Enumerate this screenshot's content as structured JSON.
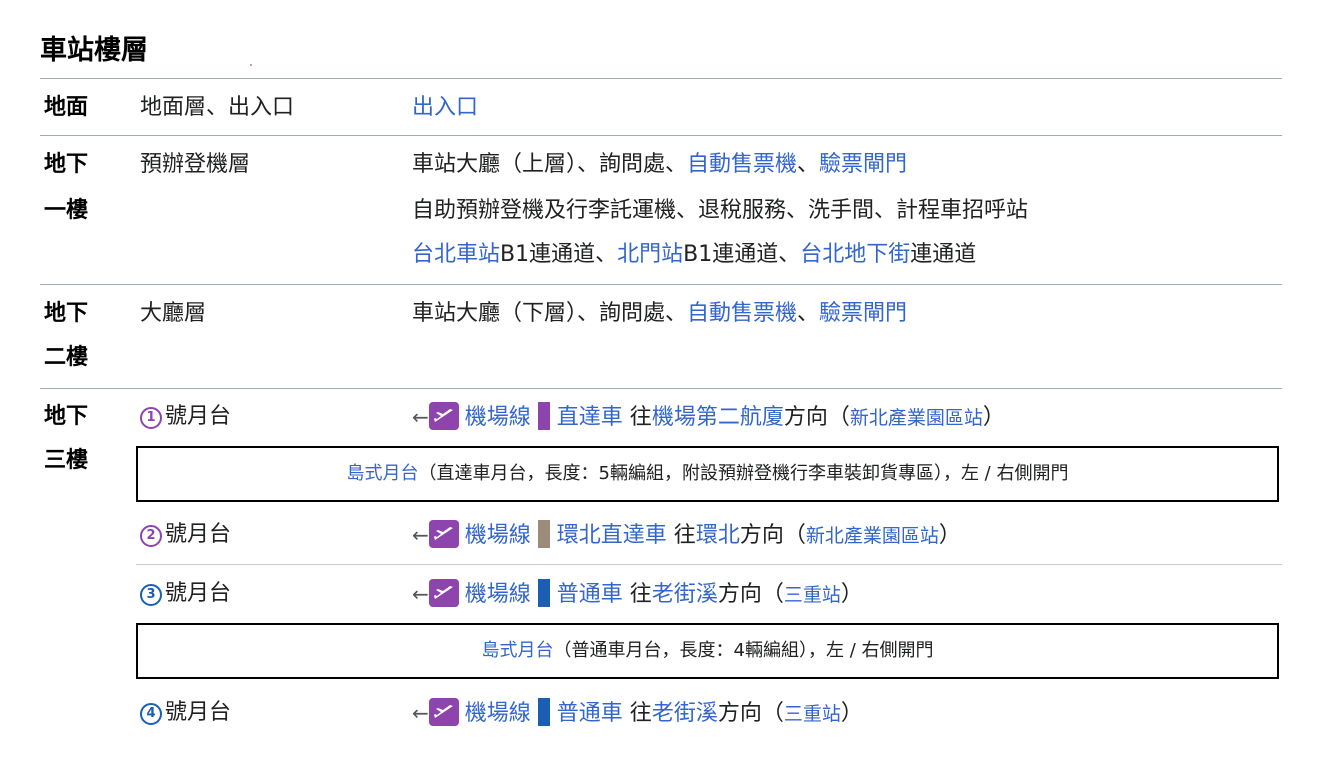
{
  "title": "車站樓層",
  "colors": {
    "link": "#3366cc",
    "airport_line": "#8e44ad",
    "express_bar": "#8e44ad",
    "loop_express_bar": "#9c8b7a",
    "commuter_bar": "#1a5fb4"
  },
  "rows": {
    "ground": {
      "level": "地面",
      "name": "地面層、出入口",
      "service_link": "出入口"
    },
    "b1": {
      "level_1": "地下",
      "level_2": "一樓",
      "name": "預辦登機層",
      "line1": {
        "text": "車站大廳（上層）、詢問處、",
        "link_a": "自動售票機",
        "sep": "、",
        "link_b": "驗票閘門"
      },
      "line2": "自助預辦登機及行李託運機、退稅服務、洗手間、計程車招呼站",
      "line3": {
        "link_a": "台北車站",
        "text_a": "B1連通道、",
        "link_b": "北門站",
        "text_b": "B1連通道、",
        "link_c": "台北地下街",
        "text_c": "連通道"
      }
    },
    "b2": {
      "level_1": "地下",
      "level_2": "二樓",
      "name": "大廳層",
      "line1": {
        "text": "車站大廳（下層）、詢問處、",
        "link_a": "自動售票機",
        "sep": "、",
        "link_b": "驗票閘門"
      }
    },
    "b3": {
      "level_1": "地下",
      "level_2": "三樓",
      "platforms": [
        {
          "num": "1",
          "label": "號月台",
          "arrow": "←",
          "line": "機場線",
          "service": "直達車",
          "toward": "往",
          "dest": "機場第二航廈",
          "dir": "方向（",
          "term": "新北產業園區站",
          "close": "）"
        },
        {
          "num": "2",
          "label": "號月台",
          "arrow": "←",
          "line": "機場線",
          "service": "環北直達車",
          "toward": "往",
          "dest": "環北",
          "dir": "方向（",
          "term": "新北產業園區站",
          "close": "）"
        },
        {
          "num": "3",
          "label": "號月台",
          "arrow": "←",
          "line": "機場線",
          "service": "普通車",
          "toward": "往",
          "dest": "老街溪",
          "dir": "方向（",
          "term": "三重站",
          "close": "）"
        },
        {
          "num": "4",
          "label": "號月台",
          "arrow": "←",
          "line": "機場線",
          "service": "普通車",
          "toward": "往",
          "dest": "老街溪",
          "dir": "方向（",
          "term": "三重站",
          "close": "）"
        }
      ],
      "island1": {
        "link": "島式月台",
        "text": "（直達車月台，長度：5輛編組，附設預辦登機行李車裝卸貨專區），左 / 右側開門"
      },
      "island2": {
        "link": "島式月台",
        "text": "（普通車月台，長度：4輛編組），左 / 右側開門"
      }
    }
  }
}
